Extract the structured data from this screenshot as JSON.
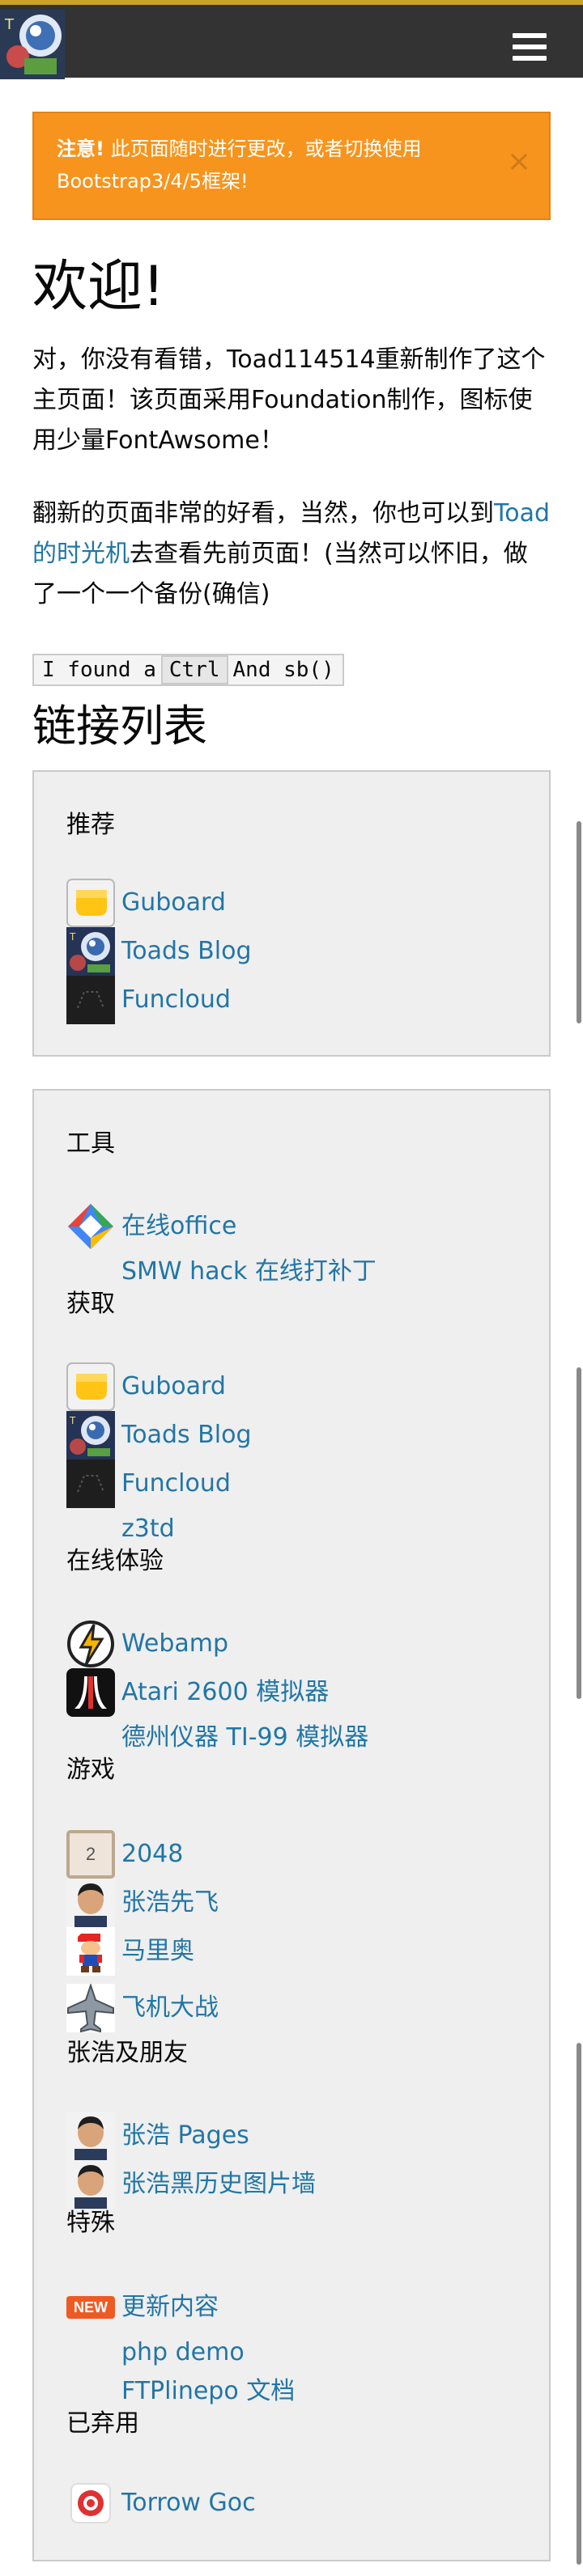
{
  "topbar": {
    "logo_icon": "toad-logo-icon",
    "menu_icon": "hamburger-icon"
  },
  "callout": {
    "strong": "注意!",
    "text": " 此页面随时进行更改，或者切换使用Bootstrap3/4/5框架!",
    "close": "×"
  },
  "welcome": {
    "title": "欢迎!"
  },
  "intro": {
    "p1": "对，你没有看错，Toad114514重新制作了这个主页面！该页面采用Foundation制作，图标使用少量FontAwsome！",
    "p2_pre": "翻新的页面非常的好看，当然，你也可以到",
    "p2_link": "Toad 的时光机",
    "p2_post": "去查看先前页面！(当然可以怀旧，做了一个一个备份(确信)"
  },
  "kbd_line": {
    "pre": "I found a",
    "key": "Ctrl",
    "post": "And sb()"
  },
  "links_heading": "链接列表",
  "recommend": {
    "title": "推荐",
    "items": [
      {
        "label": "Guboard",
        "icon": "guboard-icon"
      },
      {
        "label": "Toads Blog",
        "icon": "toads-blog-icon"
      },
      {
        "label": "Funcloud",
        "icon": "funcloud-icon"
      }
    ]
  },
  "tools": {
    "title": "工具",
    "tools_items": [
      {
        "label": "在线office",
        "icon": "office-icon"
      },
      {
        "label": "SMW hack 在线打补丁",
        "icon": ""
      }
    ],
    "get_label": "获取",
    "get_items": [
      {
        "label": "Guboard",
        "icon": "guboard-icon"
      },
      {
        "label": "Toads Blog",
        "icon": "toads-blog-icon"
      },
      {
        "label": "Funcloud",
        "icon": "funcloud-icon"
      },
      {
        "label": "z3td",
        "icon": ""
      }
    ],
    "online_label": "在线体验",
    "online_items": [
      {
        "label": "Webamp",
        "icon": "webamp-icon"
      },
      {
        "label": "Atari 2600 模拟器",
        "icon": "atari-icon"
      },
      {
        "label": "德州仪器 TI-99 模拟器",
        "icon": ""
      }
    ],
    "games_label": "游戏",
    "games_items": [
      {
        "label": "2048",
        "icon": "tile-2048-icon",
        "tile_text": "2"
      },
      {
        "label": "张浩先飞",
        "icon": "avatar-icon"
      },
      {
        "label": "马里奥",
        "icon": "mario-icon"
      },
      {
        "label": "飞机大战",
        "icon": "plane-icon"
      }
    ],
    "friends_label": "张浩及朋友",
    "friends_items": [
      {
        "label": "张浩 Pages",
        "icon": "avatar-icon"
      },
      {
        "label": "张浩黑历史图片墙",
        "icon": "avatar-icon"
      }
    ],
    "special_label": "特殊",
    "special_items": [
      {
        "label": "更新内容",
        "icon": "new-badge-icon",
        "badge_text": "NEW"
      },
      {
        "label": "php demo",
        "icon": ""
      },
      {
        "label": "FTPlinepo 文档",
        "icon": ""
      }
    ],
    "deprecated_label": "已弃用",
    "deprecated_items": [
      {
        "label": "Torrow Goc",
        "icon": "torrow-icon"
      }
    ]
  },
  "colors": {
    "topbar": "#333333",
    "callout": "#f7941d",
    "link": "#2176a6",
    "panel": "#efefef"
  }
}
